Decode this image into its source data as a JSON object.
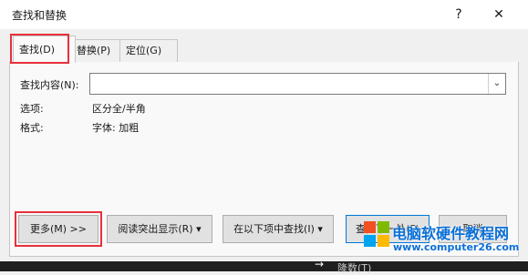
{
  "window": {
    "title": "查找和替换",
    "help": "?",
    "close": "✕"
  },
  "tabs": [
    {
      "label": "查找(D)",
      "active": true
    },
    {
      "label": "替换(P)",
      "active": false
    },
    {
      "label": "定位(G)",
      "active": false
    }
  ],
  "find": {
    "label": "查找内容(N):",
    "value": "",
    "placeholder": ""
  },
  "options": {
    "label": "选项:",
    "value": "区分全/半角",
    "format_label": "格式:",
    "format_value": "字体: 加粗"
  },
  "buttons": {
    "more": "更多(M) >>",
    "reading_highlight": "阅读突出显示(R) ▾",
    "find_in": "在以下项中查找(I) ▾",
    "find_next": "查找下一处(F)",
    "cancel": "取消"
  },
  "watermark": {
    "line1": "电脑软硬件教程网",
    "line2": "www.computer26.com"
  },
  "background_strip": {
    "text": "隆数(T)"
  },
  "colors": {
    "highlight_box": "#e8303a",
    "default_button_border": "#0078d7",
    "watermark_blue": "#0a6fd6"
  }
}
